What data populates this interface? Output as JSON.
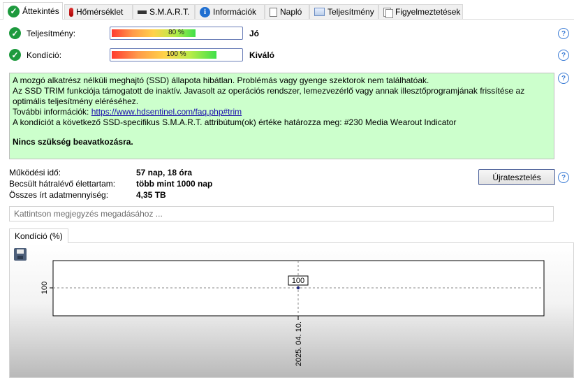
{
  "tabs": [
    {
      "label": "Áttekintés",
      "icon": "check-icon",
      "active": true
    },
    {
      "label": "Hőmérséklet",
      "icon": "thermometer-icon"
    },
    {
      "label": "S.M.A.R.T.",
      "icon": "disk-icon"
    },
    {
      "label": "Információk",
      "icon": "info-icon"
    },
    {
      "label": "Napló",
      "icon": "document-icon"
    },
    {
      "label": "Teljesítmény",
      "icon": "performance-icon"
    },
    {
      "label": "Figyelmeztetések",
      "icon": "documents-icon"
    }
  ],
  "status": {
    "performance": {
      "label": "Teljesítmény:",
      "bar_text": "80 %",
      "value": 80,
      "rating": "Jó"
    },
    "condition": {
      "label": "Kondíció:",
      "bar_text": "100 %",
      "value": 100,
      "rating": "Kiváló"
    }
  },
  "message": {
    "line1": "A mozgó alkatrész nélküli meghajtó (SSD) állapota hibátlan. Problémás vagy gyenge szektorok nem találhatóak.",
    "line2": "Az SSD TRIM funkciója támogatott de inaktív. Javasolt az operációs rendszer, lemezvezérlő vagy annak illesztőprogramjának frissítése az optimális teljesítmény eléréséhez.",
    "more_prefix": "További információk: ",
    "link": "https://www.hdsentinel.com/faq.php#trim",
    "line4": "A kondíciót a következő SSD-specifikus S.M.A.R.T. attribútum(ok) értéke határozza meg:  #230 Media Wearout Indicator",
    "conclusion": "Nincs szükség beavatkozásra."
  },
  "stats": {
    "uptime_label": "Működési idő:",
    "uptime_value": "57 nap, 18 óra",
    "remaining_label": "Becsült hátralévő élettartam:",
    "remaining_value": "több mint 1000 nap",
    "written_label": "Összes írt adatmennyiség:",
    "written_value": "4,35 TB"
  },
  "retest_button": "Újratesztelés",
  "note_placeholder": "Kattintson megjegyzés megadásához ...",
  "chart_tab": "Kondíció  (%)",
  "chart_data": {
    "type": "line",
    "x": [
      "2025. 04. 10."
    ],
    "values": [
      100
    ],
    "ytick_labels": [
      "100"
    ],
    "data_labels": [
      "100"
    ],
    "xtick_labels": [
      "2025. 04. 10."
    ],
    "grid": true
  },
  "colors": {
    "accent_green": "#1e9a3e",
    "message_bg": "#ccffcc",
    "link": "#1a0dab",
    "help": "#3a7bd5"
  }
}
